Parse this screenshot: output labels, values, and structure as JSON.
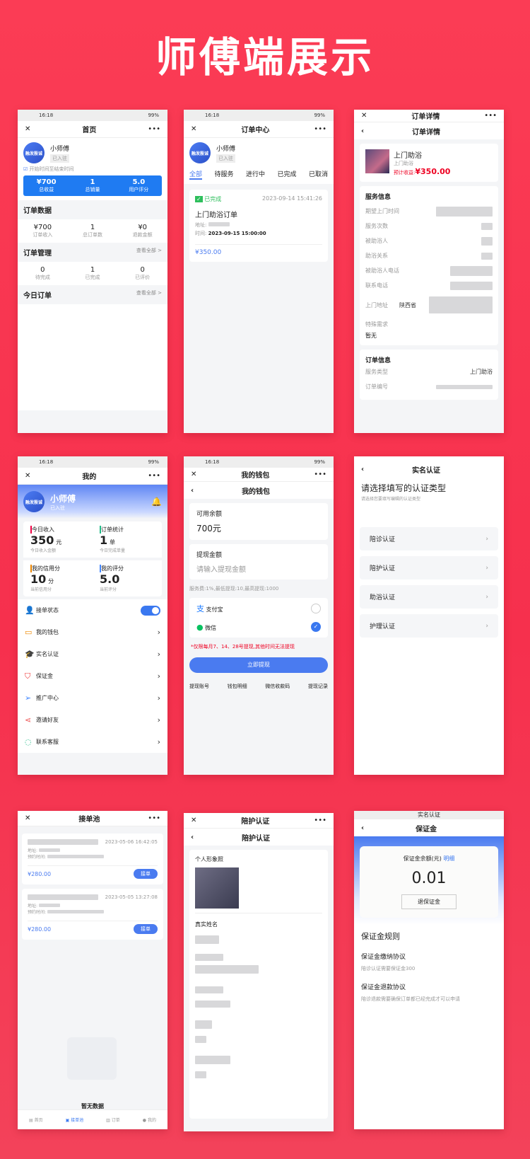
{
  "banner_title": "师傅端展示",
  "status": {
    "time": "16:18",
    "battery": "99%"
  },
  "home": {
    "title": "首页",
    "name": "小师傅",
    "badge": "已入驻",
    "avatar": "融发殷诚",
    "toggle": "开始时间至结束时间",
    "stats": [
      {
        "v": "¥700",
        "l": "总收益"
      },
      {
        "v": "1",
        "l": "总销量"
      },
      {
        "v": "5.0",
        "l": "用户评分"
      }
    ],
    "order_data_title": "订单数据",
    "order_data": [
      {
        "v": "¥700",
        "l": "订单收入"
      },
      {
        "v": "1",
        "l": "总订单数"
      },
      {
        "v": "¥0",
        "l": "退款金额"
      }
    ],
    "order_mgmt_title": "订单管理",
    "view_all": "查看全部 >",
    "order_mgmt": [
      {
        "v": "0",
        "l": "待完成"
      },
      {
        "v": "1",
        "l": "已完成"
      },
      {
        "v": "0",
        "l": "已评价"
      }
    ],
    "today_title": "今日订单"
  },
  "orders": {
    "title": "订单中心",
    "name": "小师傅",
    "badge": "已入驻",
    "tabs": [
      "全部",
      "待服务",
      "进行中",
      "已完成",
      "已取消"
    ],
    "status": "已完成",
    "datetime": "2023-09-14 15:41:26",
    "order_name": "上门助浴订单",
    "addr_label": "地址:",
    "time_label": "时间:",
    "time": "2023-09-15 15:00:00",
    "price": "¥350.00"
  },
  "detail": {
    "title": "订单详情",
    "service": "上门助浴",
    "service_sub": "上门助浴",
    "earn": "预计收益:",
    "earn_val": "¥350.00",
    "info_title": "服务信息",
    "fields": [
      "期望上门时间",
      "服务次数",
      "被助浴人",
      "助浴关系",
      "被助浴人电话",
      "联系电话",
      "上门地址"
    ],
    "addr_prefix": "陕西省",
    "special": "特殊需求",
    "special_val": "暂无",
    "order_info": "订单信息",
    "svc_type": "服务类型",
    "svc_type_val": "上门助浴",
    "order_no": "订单编号"
  },
  "mine": {
    "title": "我的",
    "name": "小师傅",
    "badge": "已入驻",
    "cards": [
      {
        "t": "今日收入",
        "v": "350",
        "u": "元",
        "s": "今日收入金额"
      },
      {
        "t": "订单统计",
        "v": "1",
        "u": "单",
        "s": "今日完成单量"
      },
      {
        "t": "我的信用分",
        "v": "10",
        "u": "分",
        "s": "当前信用分"
      },
      {
        "t": "我的评分",
        "v": "5.0",
        "u": "",
        "s": "当前评分"
      }
    ],
    "menu": [
      "接单状态",
      "我的钱包",
      "实名认证",
      "保证金",
      "推广中心",
      "邀请好友",
      "联系客服"
    ]
  },
  "wallet": {
    "title": "我的钱包",
    "balance_label": "可用余额",
    "balance": "700元",
    "withdraw_label": "提现金额",
    "placeholder": "请输入提现金额",
    "fee": "服务费:1%,最低提现:10,最高提现:1000",
    "alipay": "支付宝",
    "wechat": "微信",
    "notice": "*仅限每月7、14、28号提现,其他时间无法提现",
    "submit": "立即提现",
    "links": [
      "提现账号",
      "钱包明细",
      "微信收款码",
      "提现记录"
    ]
  },
  "realname": {
    "title": "实名认证",
    "heading": "请选择填写的认证类型",
    "sub": "请选择您要填写编辑的认证类型",
    "items": [
      "陪诊认证",
      "陪护认证",
      "助浴认证",
      "护理认证"
    ]
  },
  "pool": {
    "title": "接单池",
    "items": [
      {
        "dt": "2023-05-06 16:42:05",
        "price": "¥280.00"
      },
      {
        "dt": "2023-05-05 13:27:08",
        "price": "¥280.00"
      }
    ],
    "addr": "地址:",
    "appt": "预约时间:",
    "btn": "接单",
    "empty": "暂无数据",
    "tabs": [
      "首页",
      "接单池",
      "订单",
      "我的"
    ]
  },
  "nurse": {
    "title": "陪护认证",
    "photo": "个人形象照",
    "real_name": "真实姓名"
  },
  "deposit": {
    "top": "实名认证",
    "title": "保证金",
    "bal_label": "保证金余额(元)",
    "detail": "明细",
    "amount": "0.01",
    "refund": "退保证金",
    "rules": "保证金规则",
    "pay_title": "保证金缴纳协议",
    "pay_text": "陪诊认证需要保证金300",
    "ref_title": "保证金退款协议",
    "ref_text": "陪诊退款需要确保订单都已经完成才可以申请"
  }
}
